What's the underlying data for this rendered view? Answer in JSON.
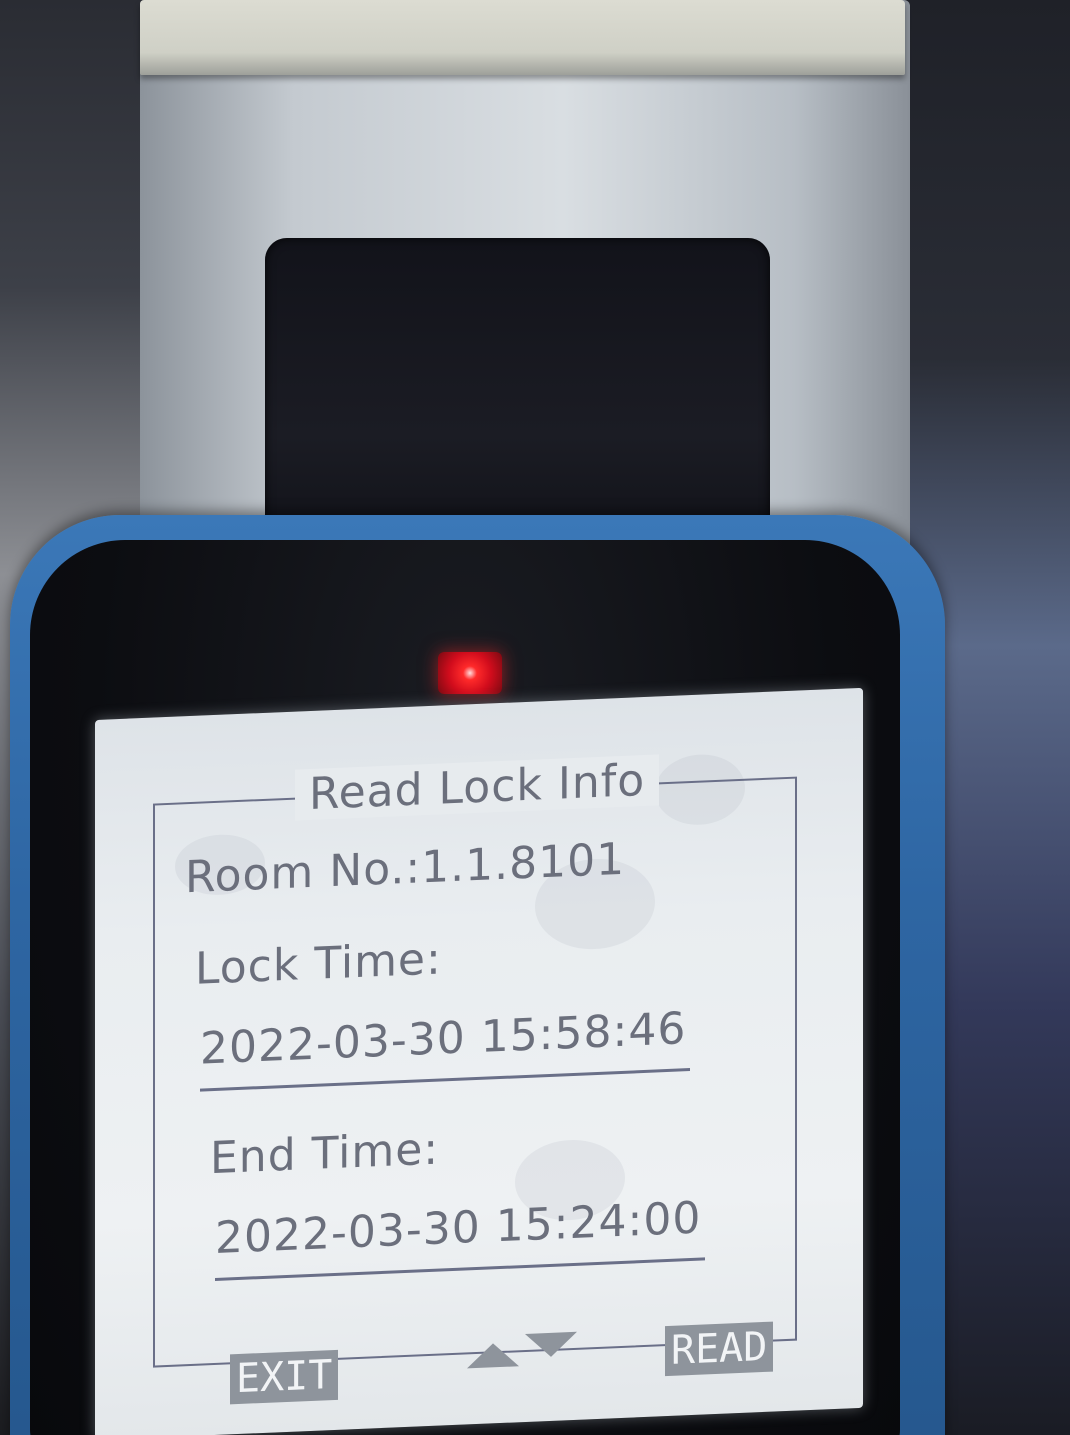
{
  "screen": {
    "title": "Read Lock Info",
    "room_line": "Room No.:1.1.8101",
    "lock_time_label": "Lock Time:",
    "lock_time_value": "2022-03-30  15:58:46",
    "end_time_label": "End Time:",
    "end_time_value": "2022-03-30  15:24:00",
    "exit_label": "EXIT",
    "read_label": "READ"
  },
  "colors": {
    "device_blue": "#2e66a3",
    "led_red": "#ff2a2a",
    "screen_bg": "#e9edf0",
    "lcd_text": "#6b6f7c"
  },
  "icons": {
    "status_led": "red-led-indicator",
    "nav_up": "triangle-up-icon",
    "nav_down": "triangle-down-icon"
  }
}
